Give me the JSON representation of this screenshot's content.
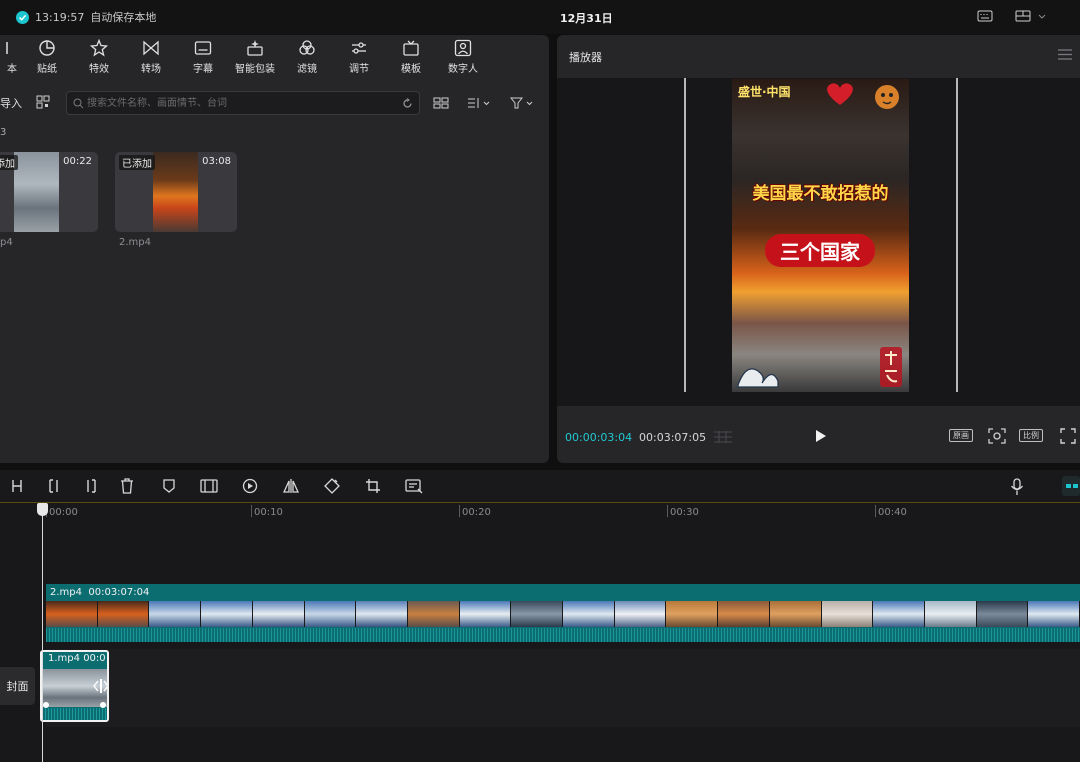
{
  "titlebar": {
    "save_time": "13:19:57",
    "save_status": "自动保存本地",
    "project_title": "12月31日"
  },
  "toolbar": {
    "items": [
      {
        "label": "本",
        "icon": "text-icon"
      },
      {
        "label": "贴纸",
        "icon": "sticker-icon"
      },
      {
        "label": "特效",
        "icon": "effects-icon"
      },
      {
        "label": "转场",
        "icon": "transition-icon"
      },
      {
        "label": "字幕",
        "icon": "caption-icon"
      },
      {
        "label": "智能包装",
        "icon": "smart-pack-icon"
      },
      {
        "label": "滤镜",
        "icon": "filter-icon"
      },
      {
        "label": "调节",
        "icon": "adjust-icon"
      },
      {
        "label": "模板",
        "icon": "template-icon"
      },
      {
        "label": "数字人",
        "icon": "digital-human-icon"
      }
    ]
  },
  "media": {
    "import_label": "导入",
    "search_placeholder": "搜索文件名称、画面情节、台词",
    "folder_label": "3",
    "items": [
      {
        "name": "p4",
        "duration": "00:22",
        "badge": "添加"
      },
      {
        "name": "2.mp4",
        "duration": "03:08",
        "badge": "已添加"
      }
    ]
  },
  "player": {
    "title": "播放器",
    "current_time": "00:00:03:04",
    "total_time": "00:03:07:05",
    "video_overlay": {
      "top_title": "盛世·中国",
      "headline": "美国最不敢招惹的",
      "subline": "三个国家"
    },
    "controls": {
      "original_label": "原画",
      "ratio_label": "比例"
    }
  },
  "timeline": {
    "ruler": [
      "00:00",
      "00:10",
      "00:20",
      "00:30",
      "00:40"
    ],
    "main_clip": {
      "name": "2.mp4",
      "duration": "00:03:07:04"
    },
    "pip_clip": {
      "name": "1.mp4",
      "duration": "00:0"
    },
    "cover_label": "封面"
  },
  "colors": {
    "accent": "#1bc6cf",
    "track": "#0c6d71",
    "panel": "#262629"
  }
}
